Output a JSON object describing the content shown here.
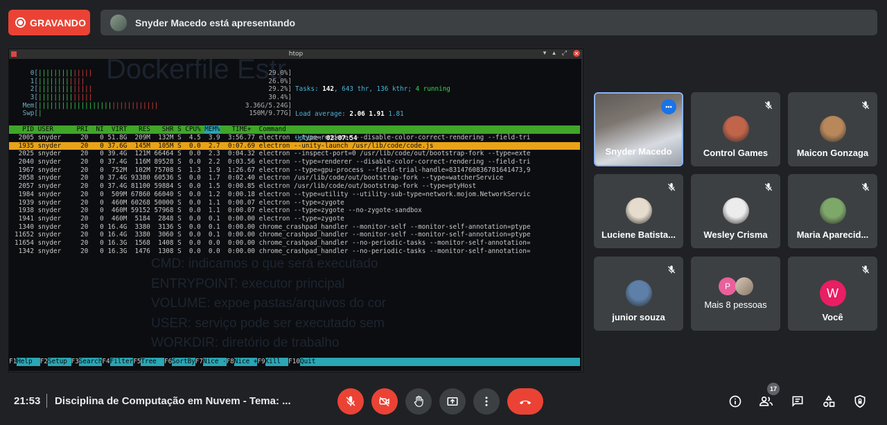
{
  "recording": {
    "label": "GRAVANDO"
  },
  "presenting": {
    "text": "Snyder Macedo está apresentando"
  },
  "window": {
    "title": "htop",
    "controls": [
      "▾",
      "▴",
      "⤢",
      "✕"
    ]
  },
  "terminal": {
    "watermark": "Dockerfile Estr",
    "background_lines": [
      "CMD: indicamos o que será executado",
      "ENTRYPOINT: executor principal",
      "VOLUME: expoe pastas/arquivos do cor",
      "USER: serviço pode ser executado sem",
      "WORKDIR: diretório de trabalho"
    ],
    "meters": [
      {
        "label": "0[",
        "value": "29.0%]",
        "level": 0.29
      },
      {
        "label": "1[",
        "value": "26.0%]",
        "level": 0.26
      },
      {
        "label": "2[",
        "value": "29.2%]",
        "level": 0.29
      },
      {
        "label": "3[",
        "value": "30.4%]",
        "level": 0.3
      },
      {
        "label": "Mem[",
        "value": "3.36G/5.24G]",
        "level": 0.64
      },
      {
        "label": "Swp[",
        "value": "150M/9.77G]",
        "level": 0.02
      }
    ],
    "tasks_label": "Tasks: ",
    "tasks": "142",
    "threads": ", 643 thr, 136 kthr; ",
    "running": "4 running",
    "load_label": "Load average: ",
    "load1": "2.06",
    "load5": " 1.91",
    "load15": " 1.81",
    "uptime_label": "Uptime: ",
    "uptime": "02:07:54",
    "header": "  PID USER      PRI  NI  VIRT   RES   SHR S CPU% ",
    "header_sort": "MEM%",
    "header_rest": "   TIME+  Command",
    "processes": [
      {
        "text": " 2005 snyder     20   0 51.8G  209M  132M S  4.5  3.9  3:56.77 electron --type=renderer --disable-color-correct-rendering --field-tri",
        "selected": false
      },
      {
        "text": " 1935 snyder     20   0 37.6G  145M  105M S  0.0  2.7  0:07.69 electron --unity-launch /usr/lib/code/code.js",
        "selected": true
      },
      {
        "text": " 2025 snyder     20   0 39.4G  121M 66464 S  0.0  2.3  0:04.32 electron --inspect-port=0 /usr/lib/code/out/bootstrap-fork --type=exte",
        "selected": false
      },
      {
        "text": " 2040 snyder     20   0 37.4G  116M 89528 S  0.0  2.2  0:03.56 electron --type=renderer --disable-color-correct-rendering --field-tri",
        "selected": false
      },
      {
        "text": " 1967 snyder     20   0  752M  102M 75708 S  1.3  1.9  1:26.67 electron --type=gpu-process --field-trial-handle=8314760836781641473,9",
        "selected": false
      },
      {
        "text": " 2058 snyder     20   0 37.4G 93380 60536 S  0.0  1.7  0:02.40 electron /usr/lib/code/out/bootstrap-fork --type=watcherService",
        "selected": false
      },
      {
        "text": " 2057 snyder     20   0 37.4G 81100 59884 S  0.0  1.5  0:00.85 electron /usr/lib/code/out/bootstrap-fork --type=ptyHost",
        "selected": false
      },
      {
        "text": " 1984 snyder     20   0  509M 67860 66040 S  0.0  1.2  0:00.18 electron --type=utility --utility-sub-type=network.mojom.NetworkServic",
        "selected": false
      },
      {
        "text": " 1939 snyder     20   0  460M 60268 50000 S  0.0  1.1  0:00.07 electron --type=zygote",
        "selected": false
      },
      {
        "text": " 1938 snyder     20   0  460M 59152 57968 S  0.0  1.1  0:00.07 electron --type=zygote --no-zygote-sandbox",
        "selected": false
      },
      {
        "text": " 1941 snyder     20   0  460M  5184  2848 S  0.0  0.1  0:00.00 electron --type=zygote",
        "selected": false
      },
      {
        "text": " 1340 snyder     20   0 16.4G  3380  3136 S  0.0  0.1  0:00.00 chrome_crashpad_handler --monitor-self --monitor-self-annotation=ptype",
        "selected": false
      },
      {
        "text": "11652 snyder     20   0 16.4G  3380  3060 S  0.0  0.1  0:00.00 chrome_crashpad_handler --monitor-self --monitor-self-annotation=ptype",
        "selected": false
      },
      {
        "text": "11654 snyder     20   0 16.3G  1568  1408 S  0.0  0.0  0:00.00 chrome_crashpad_handler --no-periodic-tasks --monitor-self-annotation=",
        "selected": false
      },
      {
        "text": " 1342 snyder     20   0 16.3G  1476  1308 S  0.0  0.0  0:00.00 chrome_crashpad_handler --no-periodic-tasks --monitor-self-annotation=",
        "selected": false
      }
    ],
    "fkeys": [
      {
        "key": "F1",
        "label": "Help  "
      },
      {
        "key": "F2",
        "label": "Setup "
      },
      {
        "key": "F3",
        "label": "Search"
      },
      {
        "key": "F4",
        "label": "Filter"
      },
      {
        "key": "F5",
        "label": "Tree  "
      },
      {
        "key": "F6",
        "label": "SortBy"
      },
      {
        "key": "F7",
        "label": "Nice -"
      },
      {
        "key": "F8",
        "label": "Nice +"
      },
      {
        "key": "F9",
        "label": "Kill  "
      },
      {
        "key": "F10",
        "label": "Quit"
      }
    ]
  },
  "participants": [
    {
      "name": "Snyder Macedo",
      "video": true
    },
    {
      "name": "Control Games",
      "muted": true,
      "avatar_color": "#c0644a"
    },
    {
      "name": "Maicon Gonzaga",
      "muted": true,
      "avatar_color": "#b9885a"
    },
    {
      "name": "Luciene Batista...",
      "muted": true,
      "avatar_color": "#e6dccd"
    },
    {
      "name": "Wesley Crisma",
      "muted": true,
      "avatar_color": "#ececec"
    },
    {
      "name": "Maria Aparecid...",
      "muted": true,
      "avatar_color": "#7ea86a"
    },
    {
      "name": "junior souza",
      "muted": true,
      "avatar_color": "#5d7fa8"
    },
    {
      "name": "Mais 8 pessoas",
      "initial": "P"
    },
    {
      "name": "Você",
      "muted": true,
      "initial": "W"
    }
  ],
  "bottom": {
    "time": "21:53",
    "meeting_title": "Disciplina de Computação em Nuvem - Tema: ...",
    "people_count": "17"
  },
  "colors": {
    "recording_red": "#ea4335",
    "accent_blue": "#8ab4f8",
    "you_avatar": "#e91e63",
    "p_avatar": "#e8619b"
  }
}
